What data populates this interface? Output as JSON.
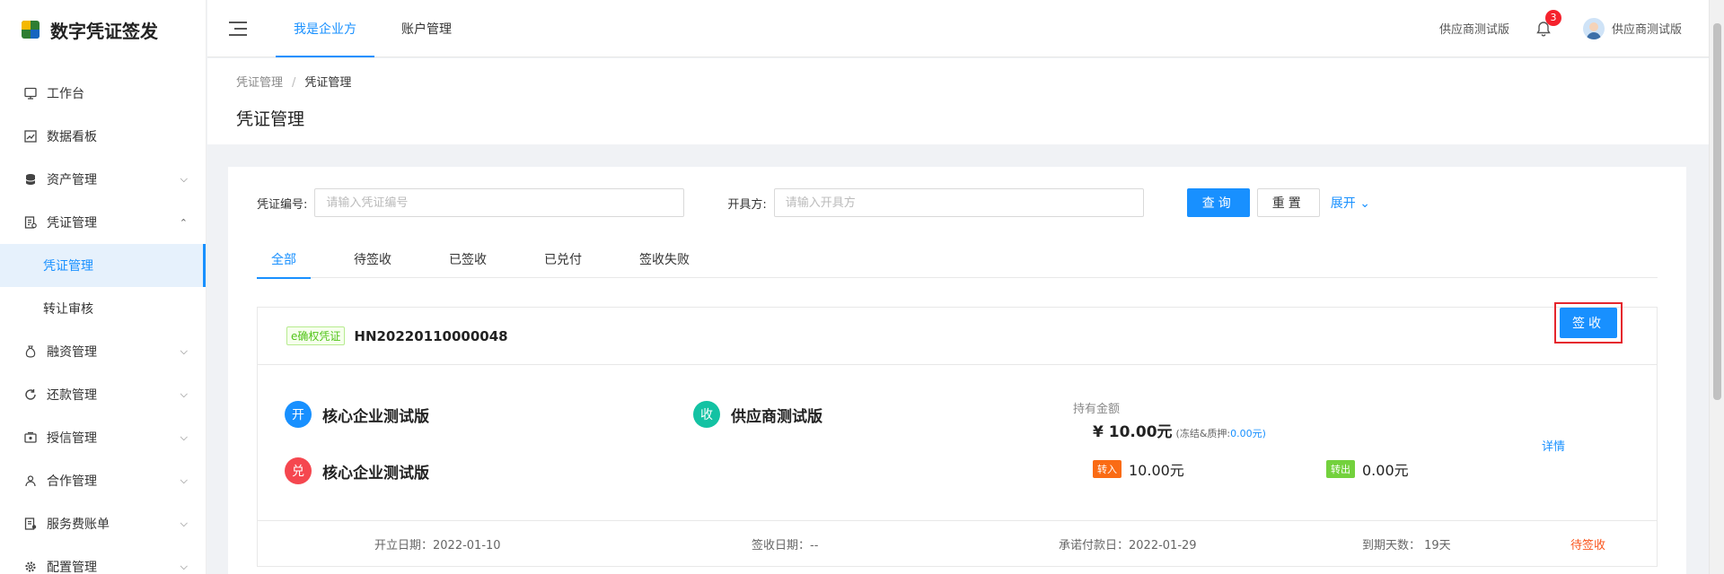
{
  "app": {
    "title": "数字凭证签发"
  },
  "sidebar": {
    "items": [
      {
        "label": "工作台",
        "icon": "monitor-icon"
      },
      {
        "label": "数据看板",
        "icon": "chart-icon"
      },
      {
        "label": "资产管理",
        "icon": "database-icon"
      },
      {
        "label": "凭证管理",
        "icon": "document-icon"
      },
      {
        "label": "凭证管理"
      },
      {
        "label": "转让审核"
      },
      {
        "label": "融资管理",
        "icon": "money-bag-icon"
      },
      {
        "label": "还款管理",
        "icon": "refresh-icon"
      },
      {
        "label": "授信管理",
        "icon": "credit-icon"
      },
      {
        "label": "合作管理",
        "icon": "partner-icon"
      },
      {
        "label": "服务费账单",
        "icon": "bill-icon"
      },
      {
        "label": "配置管理",
        "icon": "settings-icon"
      }
    ]
  },
  "header": {
    "tabs": [
      {
        "label": "我是企业方"
      },
      {
        "label": "账户管理"
      }
    ],
    "org_name": "供应商测试版",
    "notification_count": "3",
    "user_name": "供应商测试版"
  },
  "breadcrumb": {
    "parent": "凭证管理",
    "sep": "/",
    "current": "凭证管理"
  },
  "page_title": "凭证管理",
  "filters": {
    "code_label": "凭证编号:",
    "code_placeholder": "请输入凭证编号",
    "issuer_label": "开具方:",
    "issuer_placeholder": "请输入开具方",
    "query_label": "查询",
    "reset_label": "重置",
    "expand_label": "展开"
  },
  "tabs": [
    {
      "label": "全部"
    },
    {
      "label": "待签收"
    },
    {
      "label": "已签收"
    },
    {
      "label": "已兑付"
    },
    {
      "label": "签收失败"
    }
  ],
  "voucher": {
    "tag": "e确权凭证",
    "code": "HN20220110000048",
    "sign_label": "签收",
    "issuer_badge": "开",
    "issuer": "核心企业测试版",
    "receiver_badge": "收",
    "receiver": "供应商测试版",
    "payer_badge": "兑",
    "payer": "核心企业测试版",
    "hold_label": "持有金额",
    "hold_amount": "¥ 10.00元",
    "frozen_label": "(冻结&质押:",
    "frozen_value": "0.00元)",
    "in_tag": "转入",
    "in_amount": "10.00元",
    "out_tag": "转出",
    "out_amount": "0.00元",
    "detail_label": "详情",
    "open_date": "开立日期：2022-01-10",
    "sign_date": "签收日期：--",
    "promise_date": "承诺付款日：2022-01-29",
    "days_left": "到期天数：  19天",
    "status": "待签收"
  },
  "colors": {
    "primary": "#1890ff",
    "issuer_badge": "#1890ff",
    "receiver_badge": "#13c2a3",
    "payer_badge": "#f5474f",
    "in_tag": "#fa6b14",
    "out_tag": "#73d13d",
    "status": "#fa541c"
  }
}
